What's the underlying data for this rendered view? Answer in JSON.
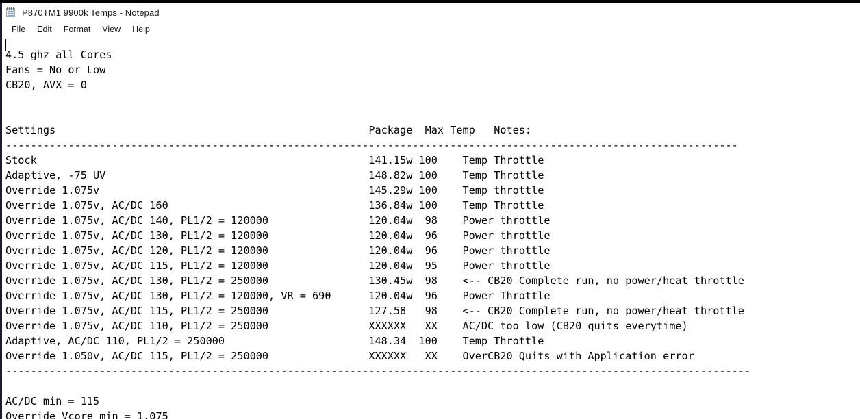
{
  "window": {
    "title": "P870TM1 9900k Temps - Notepad",
    "app_icon": "notepad-icon"
  },
  "menu": {
    "items": [
      {
        "label": "File"
      },
      {
        "label": "Edit"
      },
      {
        "label": "Format"
      },
      {
        "label": "View"
      },
      {
        "label": "Help"
      }
    ]
  },
  "document": {
    "intro_lines": [
      "4.5 ghz all Cores",
      "Fans = No or Low",
      "CB20, AVX = 0"
    ],
    "blank_lines_after_intro": 2,
    "header": {
      "settings": "Settings",
      "package": "Package",
      "max_temp": "Max Temp",
      "notes": "Notes:"
    },
    "separator_top": "---------------------------------------------------------------------------------------------------------------------",
    "separator_bottom": "-----------------------------------------------------------------------------------------------------------------------",
    "rows": [
      {
        "settings": "Stock",
        "package": "141.15w",
        "max_temp": "100",
        "notes": "Temp Throttle"
      },
      {
        "settings": "Adaptive, -75 UV",
        "package": "148.82w",
        "max_temp": "100",
        "notes": "Temp Throttle"
      },
      {
        "settings": "Override 1.075v",
        "package": "145.29w",
        "max_temp": "100",
        "notes": "Temp throttle"
      },
      {
        "settings": "Override 1.075v, AC/DC 160",
        "package": "136.84w",
        "max_temp": "100",
        "notes": "Temp Throttle"
      },
      {
        "settings": "Override 1.075v, AC/DC 140, PL1/2 = 120000",
        "package": "120.04w",
        "max_temp": "98",
        "notes": "Power throttle"
      },
      {
        "settings": "Override 1.075v, AC/DC 130, PL1/2 = 120000",
        "package": "120.04w",
        "max_temp": "96",
        "notes": "Power throttle"
      },
      {
        "settings": "Override 1.075v, AC/DC 120, PL1/2 = 120000",
        "package": "120.04w",
        "max_temp": "96",
        "notes": "Power throttle"
      },
      {
        "settings": "Override 1.075v, AC/DC 115, PL1/2 = 120000",
        "package": "120.04w",
        "max_temp": "95",
        "notes": "Power throttle"
      },
      {
        "settings": "Override 1.075v, AC/DC 130, PL1/2 = 250000",
        "package": "130.45w",
        "max_temp": "98",
        "notes": "<-- CB20 Complete run, no power/heat throttle"
      },
      {
        "settings": "Override 1.075v, AC/DC 130, PL1/2 = 120000, VR = 690",
        "package": "120.04w",
        "max_temp": "96",
        "notes": "Power Throttle"
      },
      {
        "settings": "Override 1.075v, AC/DC 115, PL1/2 = 250000",
        "package": "127.58",
        "max_temp": "98",
        "notes": "<-- CB20 Complete run, no power/heat throttle"
      },
      {
        "settings": "Override 1.075v, AC/DC 110, PL1/2 = 250000",
        "package": "XXXXXX",
        "max_temp": "XX",
        "notes": "AC/DC too low (CB20 quits everytime)"
      },
      {
        "settings": "Adaptive, AC/DC 110, PL1/2 = 250000",
        "package": "148.34",
        "max_temp": "100",
        "notes": "Temp Throttle"
      },
      {
        "settings": "Override 1.050v, AC/DC 115, PL1/2 = 250000",
        "package": "XXXXXX",
        "max_temp": "XX",
        "notes": "OverCB20 Quits with Application error"
      }
    ],
    "footer_lines": [
      "AC/DC min = 115",
      "Override Vcore min = 1.075"
    ]
  },
  "columns": {
    "settings_col": 0,
    "package_col": 58,
    "max_temp_col": 67,
    "notes_col": 78
  },
  "colors": {
    "text": "#000000",
    "background": "#ffffff",
    "window_border": "#1b1b2b",
    "title_text": "#1a1a1a"
  }
}
